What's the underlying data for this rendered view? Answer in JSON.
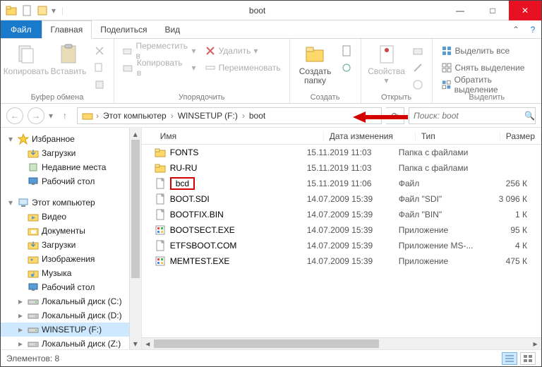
{
  "window": {
    "title": "boot"
  },
  "tabs": {
    "file": "Файл",
    "home": "Главная",
    "share": "Поделиться",
    "view": "Вид"
  },
  "ribbon": {
    "clipboard": {
      "copy": "Копировать",
      "paste": "Вставить",
      "label": "Буфер обмена"
    },
    "organize": {
      "moveTo": "Переместить в",
      "copyTo": "Копировать в",
      "delete": "Удалить",
      "rename": "Переименовать",
      "label": "Упорядочить"
    },
    "new": {
      "newFolder": "Создать\nпапку",
      "label": "Создать"
    },
    "open": {
      "properties": "Свойства",
      "label": "Открыть"
    },
    "select": {
      "selectAll": "Выделить все",
      "selectNone": "Снять выделение",
      "invert": "Обратить выделение",
      "label": "Выделить"
    }
  },
  "breadcrumb": {
    "pc": "Этот компьютер",
    "drive": "WINSETUP (F:)",
    "folder": "boot"
  },
  "search": {
    "placeholder": "Поиск: boot"
  },
  "tree": {
    "favorites": "Избранное",
    "fav_items": [
      "Загрузки",
      "Недавние места",
      "Рабочий стол"
    ],
    "thispc": "Этот компьютер",
    "pc_items": [
      "Видео",
      "Документы",
      "Загрузки",
      "Изображения",
      "Музыка",
      "Рабочий стол",
      "Локальный диск (C:)",
      "Локальный диск (D:)",
      "WINSETUP (F:)",
      "Локальный диск (Z:)"
    ]
  },
  "columns": {
    "name": "Имя",
    "date": "Дата изменения",
    "type": "Тип",
    "size": "Размер"
  },
  "files": [
    {
      "name": "FONTS",
      "date": "15.11.2019 11:03",
      "type": "Папка с файлами",
      "size": "",
      "icon": "folder"
    },
    {
      "name": "RU-RU",
      "date": "15.11.2019 11:03",
      "type": "Папка с файлами",
      "size": "",
      "icon": "folder"
    },
    {
      "name": "bcd",
      "date": "15.11.2019 11:06",
      "type": "Файл",
      "size": "256 К",
      "icon": "file",
      "highlight": true
    },
    {
      "name": "BOOT.SDI",
      "date": "14.07.2009 15:39",
      "type": "Файл \"SDI\"",
      "size": "3 096 К",
      "icon": "file"
    },
    {
      "name": "BOOTFIX.BIN",
      "date": "14.07.2009 15:39",
      "type": "Файл \"BIN\"",
      "size": "1 К",
      "icon": "file"
    },
    {
      "name": "BOOTSECT.EXE",
      "date": "14.07.2009 15:39",
      "type": "Приложение",
      "size": "95 К",
      "icon": "exe"
    },
    {
      "name": "ETFSBOOT.COM",
      "date": "14.07.2009 15:39",
      "type": "Приложение MS-...",
      "size": "4 К",
      "icon": "file"
    },
    {
      "name": "MEMTEST.EXE",
      "date": "14.07.2009 15:39",
      "type": "Приложение",
      "size": "475 К",
      "icon": "exe"
    }
  ],
  "status": {
    "count": "Элементов: 8"
  },
  "colors": {
    "accent": "#1979ca",
    "close": "#e81123",
    "highlight": "#d40000",
    "selection": "#cde8ff"
  }
}
